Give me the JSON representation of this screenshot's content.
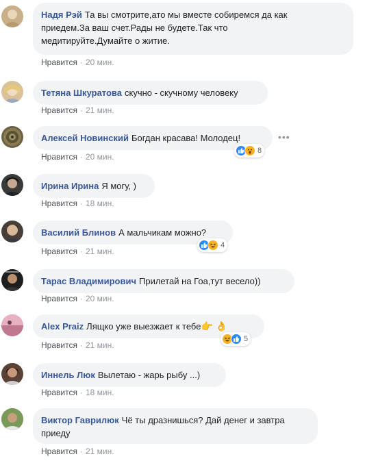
{
  "comments": [
    {
      "author": "Надя Рэй",
      "text": "Та вы смотрите,ато мы вместе собиремся да как",
      "text2": "приедем.За ваш счет.Рады не будете.Так что",
      "text3": "медитируйте.Думайте о житие.",
      "like": "Нравится",
      "time": "20 мин.",
      "avatar_color": "#c9b08a"
    },
    {
      "author": "Тетяна Шкуратова",
      "text": "скучно - скучному человеку",
      "like": "Нравится",
      "time": "21 мин.",
      "avatar_color": "#d9c29a"
    },
    {
      "author": "Алексей Новинский",
      "text": "Богдан красава! Молодец!",
      "like": "Нравится",
      "time": "20 мин.",
      "reaction_count": "8",
      "avatar_color": "#6a6246"
    },
    {
      "author": "Ирина Ирина",
      "text": "Я могу, )",
      "like": "Нравится",
      "time": "18 мин.",
      "avatar_color": "#3a3a3a"
    },
    {
      "author": "Василий Блинов",
      "text": "А мальчикам можно?",
      "like": "Нравится",
      "time": "21 мин.",
      "reaction_count": "4",
      "avatar_color": "#4a3f38"
    },
    {
      "author": "Тарас Владимирович",
      "text": "Прилетай на Гоа,тут весело))",
      "like": "Нравится",
      "time": "20 мин.",
      "avatar_color": "#1e1e1e"
    },
    {
      "author": "Alex Praiz",
      "text": "Лящко уже выезжает к тебе",
      "like": "Нравится",
      "time": "21 мин.",
      "reaction_count": "5",
      "avatar_color": "#d89aa8",
      "emoji_after": "👉 👌"
    },
    {
      "author": "Иннель Люк",
      "text": "Вылетаю - жарь рыбу ...)",
      "like": "Нравится",
      "time": "18 мин.",
      "avatar_color": "#5a4336"
    },
    {
      "author": "Виктор Гаврилюк",
      "text": "Чё ты дразнишься? Дай денег и завтра",
      "text2": "приеду",
      "like": "Нравится",
      "time": "21 мин.",
      "avatar_color": "#8a9a6a"
    }
  ],
  "separator": "·"
}
